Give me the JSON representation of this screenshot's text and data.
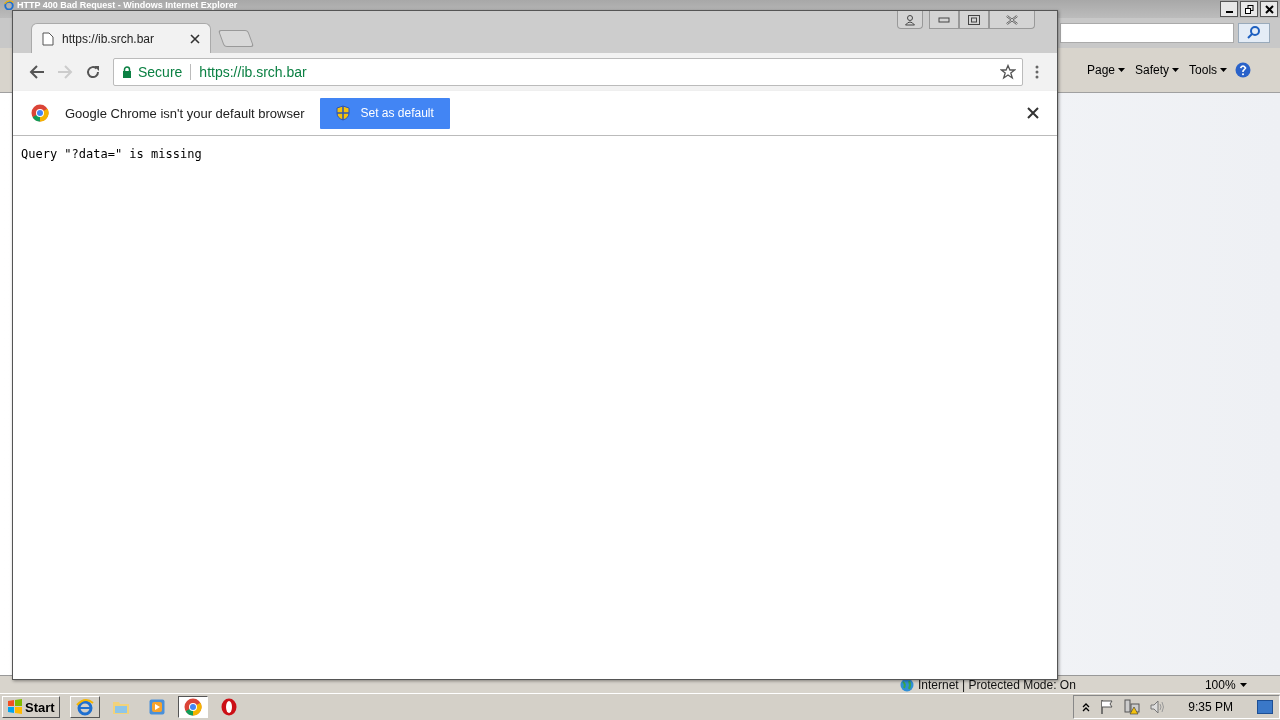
{
  "ie_window": {
    "title": "HTTP 400 Bad Request - Windows Internet Explorer",
    "command_bar": [
      "Page",
      "Safety",
      "Tools"
    ],
    "status": "Internet | Protected Mode: On",
    "zoom": "100%"
  },
  "chrome": {
    "tab": {
      "title": "https://ib.srch.bar",
      "selected": true
    },
    "address": {
      "security": "Secure",
      "url": "https://ib.srch.bar"
    },
    "infobar": {
      "message": "Google Chrome isn't your default browser",
      "button": "Set as default"
    },
    "page_text": "Query \"?data=\" is missing"
  },
  "taskbar": {
    "start": "Start",
    "apps": [
      {
        "kind": "ie",
        "selected": false
      },
      {
        "kind": "folder",
        "selected": false
      },
      {
        "kind": "media",
        "selected": false
      },
      {
        "kind": "chrome",
        "selected": true
      },
      {
        "kind": "opera",
        "selected": false
      }
    ],
    "clock": "9:35 PM"
  }
}
